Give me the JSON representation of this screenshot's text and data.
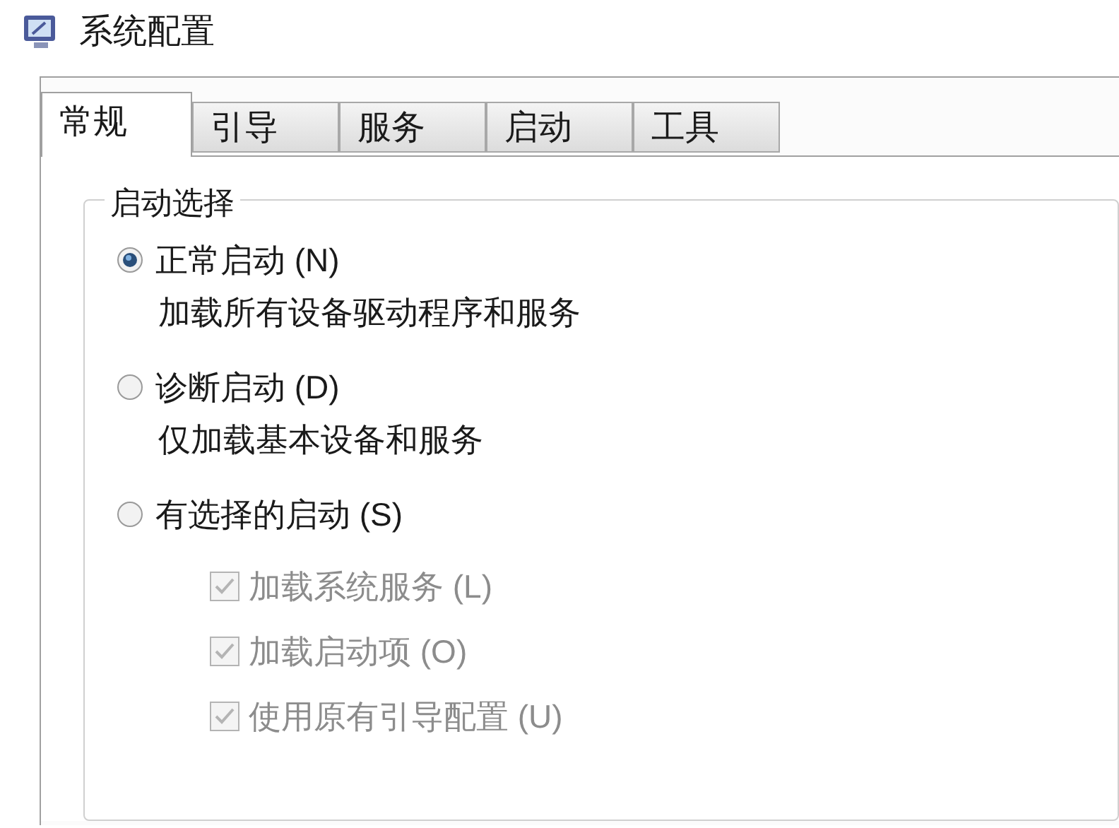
{
  "window": {
    "title": "系统配置"
  },
  "tabs": [
    {
      "label": "常规",
      "selected": true
    },
    {
      "label": "引导",
      "selected": false
    },
    {
      "label": "服务",
      "selected": false
    },
    {
      "label": "启动",
      "selected": false
    },
    {
      "label": "工具",
      "selected": false
    }
  ],
  "startup_selection": {
    "title": "启动选择",
    "options": [
      {
        "label": "正常启动 (N)",
        "description": "加载所有设备驱动程序和服务",
        "selected": true
      },
      {
        "label": "诊断启动 (D)",
        "description": "仅加载基本设备和服务",
        "selected": false
      },
      {
        "label": "有选择的启动 (S)",
        "selected": false
      }
    ],
    "checkboxes": [
      {
        "label": "加载系统服务 (L)",
        "checked": true,
        "disabled": true
      },
      {
        "label": "加载启动项 (O)",
        "checked": true,
        "disabled": true
      },
      {
        "label": "使用原有引导配置 (U)",
        "checked": true,
        "disabled": true
      }
    ]
  }
}
